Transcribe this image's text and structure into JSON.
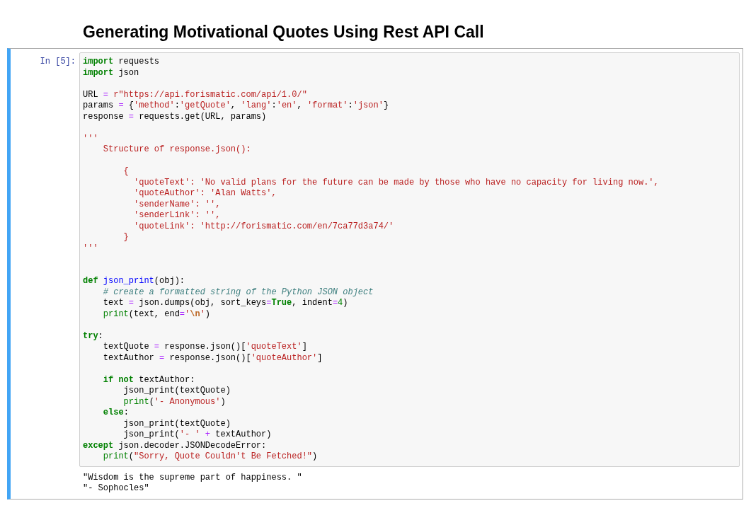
{
  "title": "Generating Motivational Quotes Using Rest API Call",
  "cell": {
    "prompt": "In [5]:",
    "selected": true,
    "code_lines": [
      {
        "kind": "code",
        "tokens": [
          {
            "t": "import",
            "kind": "kw"
          },
          {
            "t": " requests",
            "kind": "plain"
          }
        ]
      },
      {
        "kind": "code",
        "tokens": [
          {
            "t": "import",
            "kind": "kw"
          },
          {
            "t": " json",
            "kind": "plain"
          }
        ]
      },
      {
        "kind": "blank"
      },
      {
        "kind": "code",
        "tokens": [
          {
            "t": "URL ",
            "kind": "plain"
          },
          {
            "t": "=",
            "kind": "op"
          },
          {
            "t": " r\"https://api.forismatic.com/api/1.0/\"",
            "kind": "str"
          }
        ]
      },
      {
        "kind": "code",
        "tokens": [
          {
            "t": "params ",
            "kind": "plain"
          },
          {
            "t": "=",
            "kind": "op"
          },
          {
            "t": " {",
            "kind": "plain"
          },
          {
            "t": "'method'",
            "kind": "str"
          },
          {
            "t": ":",
            "kind": "plain"
          },
          {
            "t": "'getQuote'",
            "kind": "str"
          },
          {
            "t": ", ",
            "kind": "plain"
          },
          {
            "t": "'lang'",
            "kind": "str"
          },
          {
            "t": ":",
            "kind": "plain"
          },
          {
            "t": "'en'",
            "kind": "str"
          },
          {
            "t": ", ",
            "kind": "plain"
          },
          {
            "t": "'format'",
            "kind": "str"
          },
          {
            "t": ":",
            "kind": "plain"
          },
          {
            "t": "'json'",
            "kind": "str"
          },
          {
            "t": "}",
            "kind": "plain"
          }
        ]
      },
      {
        "kind": "code",
        "tokens": [
          {
            "t": "response ",
            "kind": "plain"
          },
          {
            "t": "=",
            "kind": "op"
          },
          {
            "t": " requests.get(URL, params)",
            "kind": "plain"
          }
        ]
      },
      {
        "kind": "blank"
      },
      {
        "kind": "code",
        "tokens": [
          {
            "t": "'''",
            "kind": "str"
          }
        ]
      },
      {
        "kind": "code",
        "tokens": [
          {
            "t": "    Structure of response.json():",
            "kind": "str"
          }
        ]
      },
      {
        "kind": "blank"
      },
      {
        "kind": "code",
        "tokens": [
          {
            "t": "        {",
            "kind": "str"
          }
        ]
      },
      {
        "kind": "code",
        "tokens": [
          {
            "t": "          'quoteText': 'No valid plans for the future can be made by those who have no capacity for living now.',",
            "kind": "str"
          }
        ]
      },
      {
        "kind": "code",
        "tokens": [
          {
            "t": "          'quoteAuthor': 'Alan Watts',",
            "kind": "str"
          }
        ]
      },
      {
        "kind": "code",
        "tokens": [
          {
            "t": "          'senderName': '',",
            "kind": "str"
          }
        ]
      },
      {
        "kind": "code",
        "tokens": [
          {
            "t": "          'senderLink': '',",
            "kind": "str"
          }
        ]
      },
      {
        "kind": "code",
        "tokens": [
          {
            "t": "          'quoteLink': 'http://forismatic.com/en/7ca77d3a74/'",
            "kind": "str"
          }
        ]
      },
      {
        "kind": "code",
        "tokens": [
          {
            "t": "        }",
            "kind": "str"
          }
        ]
      },
      {
        "kind": "code",
        "tokens": [
          {
            "t": "'''",
            "kind": "str"
          }
        ]
      },
      {
        "kind": "blank"
      },
      {
        "kind": "blank"
      },
      {
        "kind": "code",
        "tokens": [
          {
            "t": "def",
            "kind": "kw"
          },
          {
            "t": " json_print",
            "kind": "defname"
          },
          {
            "t": "(obj):",
            "kind": "plain"
          }
        ]
      },
      {
        "kind": "code",
        "tokens": [
          {
            "t": "    # create a formatted string of the Python JSON object",
            "kind": "comment"
          }
        ]
      },
      {
        "kind": "code",
        "tokens": [
          {
            "t": "    text ",
            "kind": "plain"
          },
          {
            "t": "=",
            "kind": "op"
          },
          {
            "t": " json.dumps(obj, sort_keys",
            "kind": "plain"
          },
          {
            "t": "=",
            "kind": "op"
          },
          {
            "t": "True",
            "kind": "kw"
          },
          {
            "t": ", indent",
            "kind": "plain"
          },
          {
            "t": "=",
            "kind": "op"
          },
          {
            "t": "4",
            "kind": "num"
          },
          {
            "t": ")",
            "kind": "plain"
          }
        ]
      },
      {
        "kind": "code",
        "tokens": [
          {
            "t": "    print",
            "kind": "builtin"
          },
          {
            "t": "(text, end",
            "kind": "plain"
          },
          {
            "t": "=",
            "kind": "op"
          },
          {
            "t": "'",
            "kind": "str"
          },
          {
            "t": "\\n",
            "kind": "esc"
          },
          {
            "t": "'",
            "kind": "str"
          },
          {
            "t": ")",
            "kind": "plain"
          }
        ]
      },
      {
        "kind": "blank"
      },
      {
        "kind": "code",
        "tokens": [
          {
            "t": "try",
            "kind": "kw"
          },
          {
            "t": ":",
            "kind": "plain"
          }
        ]
      },
      {
        "kind": "code",
        "tokens": [
          {
            "t": "    textQuote ",
            "kind": "plain"
          },
          {
            "t": "=",
            "kind": "op"
          },
          {
            "t": " response.json()[",
            "kind": "plain"
          },
          {
            "t": "'quoteText'",
            "kind": "str"
          },
          {
            "t": "]",
            "kind": "plain"
          }
        ]
      },
      {
        "kind": "code",
        "tokens": [
          {
            "t": "    textAuthor ",
            "kind": "plain"
          },
          {
            "t": "=",
            "kind": "op"
          },
          {
            "t": " response.json()[",
            "kind": "plain"
          },
          {
            "t": "'quoteAuthor'",
            "kind": "str"
          },
          {
            "t": "]",
            "kind": "plain"
          }
        ]
      },
      {
        "kind": "blank"
      },
      {
        "kind": "code",
        "tokens": [
          {
            "t": "    if",
            "kind": "kw"
          },
          {
            "t": " not",
            "kind": "kw"
          },
          {
            "t": " textAuthor:",
            "kind": "plain"
          }
        ]
      },
      {
        "kind": "code",
        "tokens": [
          {
            "t": "        json_print(textQuote)",
            "kind": "plain"
          }
        ]
      },
      {
        "kind": "code",
        "tokens": [
          {
            "t": "        print",
            "kind": "builtin"
          },
          {
            "t": "(",
            "kind": "plain"
          },
          {
            "t": "'- Anonymous'",
            "kind": "str"
          },
          {
            "t": ")",
            "kind": "plain"
          }
        ]
      },
      {
        "kind": "code",
        "tokens": [
          {
            "t": "    else",
            "kind": "kw"
          },
          {
            "t": ":",
            "kind": "plain"
          }
        ]
      },
      {
        "kind": "code",
        "tokens": [
          {
            "t": "        json_print(textQuote)",
            "kind": "plain"
          }
        ]
      },
      {
        "kind": "code",
        "tokens": [
          {
            "t": "        json_print(",
            "kind": "plain"
          },
          {
            "t": "'- '",
            "kind": "str"
          },
          {
            "t": " +",
            "kind": "op"
          },
          {
            "t": " textAuthor)",
            "kind": "plain"
          }
        ]
      },
      {
        "kind": "code",
        "tokens": [
          {
            "t": "except",
            "kind": "kw"
          },
          {
            "t": " json.decoder.JSONDecodeError:",
            "kind": "plain"
          }
        ]
      },
      {
        "kind": "code",
        "tokens": [
          {
            "t": "    print",
            "kind": "builtin"
          },
          {
            "t": "(",
            "kind": "plain"
          },
          {
            "t": "\"Sorry, Quote Couldn't Be Fetched!\"",
            "kind": "str"
          },
          {
            "t": ")",
            "kind": "plain"
          }
        ]
      }
    ],
    "output_lines": [
      "\"Wisdom is the supreme part of happiness. \"",
      "\"- Sophocles\""
    ]
  }
}
